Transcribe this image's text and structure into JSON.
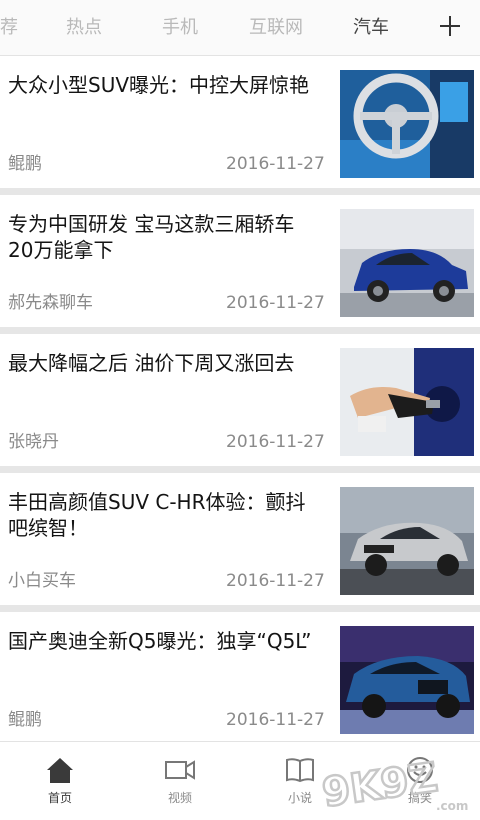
{
  "tabs": [
    {
      "label": "推荐",
      "active": false
    },
    {
      "label": "热点",
      "active": false
    },
    {
      "label": "手机",
      "active": false
    },
    {
      "label": "互联网",
      "active": false
    },
    {
      "label": "汽车",
      "active": true
    }
  ],
  "add_tab_icon": "plus-icon",
  "articles": [
    {
      "title": "大众小型SUV曝光：中控大屏惊艳",
      "source": "鲲鹏",
      "date": "2016-11-27",
      "image": "car-interior-photo"
    },
    {
      "title": "专为中国研发 宝马这款三厢轿车20万能拿下",
      "source": "郝先森聊车",
      "date": "2016-11-27",
      "image": "blue-bmw-photo"
    },
    {
      "title": "最大降幅之后 油价下周又涨回去",
      "source": "张晓丹",
      "date": "2016-11-27",
      "image": "fuel-nozzle-photo"
    },
    {
      "title": "丰田高颜值SUV C-HR体验：颤抖吧缤智！",
      "source": "小白买车",
      "date": "2016-11-27",
      "image": "toyota-chr-photo"
    },
    {
      "title": "国产奥迪全新Q5曝光：独享“Q5L”",
      "source": "鲲鹏",
      "date": "2016-11-27",
      "image": "audi-q5-photo"
    }
  ],
  "bottom_nav": [
    {
      "label": "首页",
      "icon": "home-icon",
      "active": true
    },
    {
      "label": "视频",
      "icon": "video-icon",
      "active": false
    },
    {
      "label": "小说",
      "icon": "book-icon",
      "active": false
    },
    {
      "label": "搞笑",
      "icon": "smile-icon",
      "active": false
    }
  ],
  "watermark": "9K9Z.com",
  "colors": {
    "active_tab": "#444444",
    "inactive_tab": "#b9b9b9",
    "divider": "#e6e6e6"
  }
}
